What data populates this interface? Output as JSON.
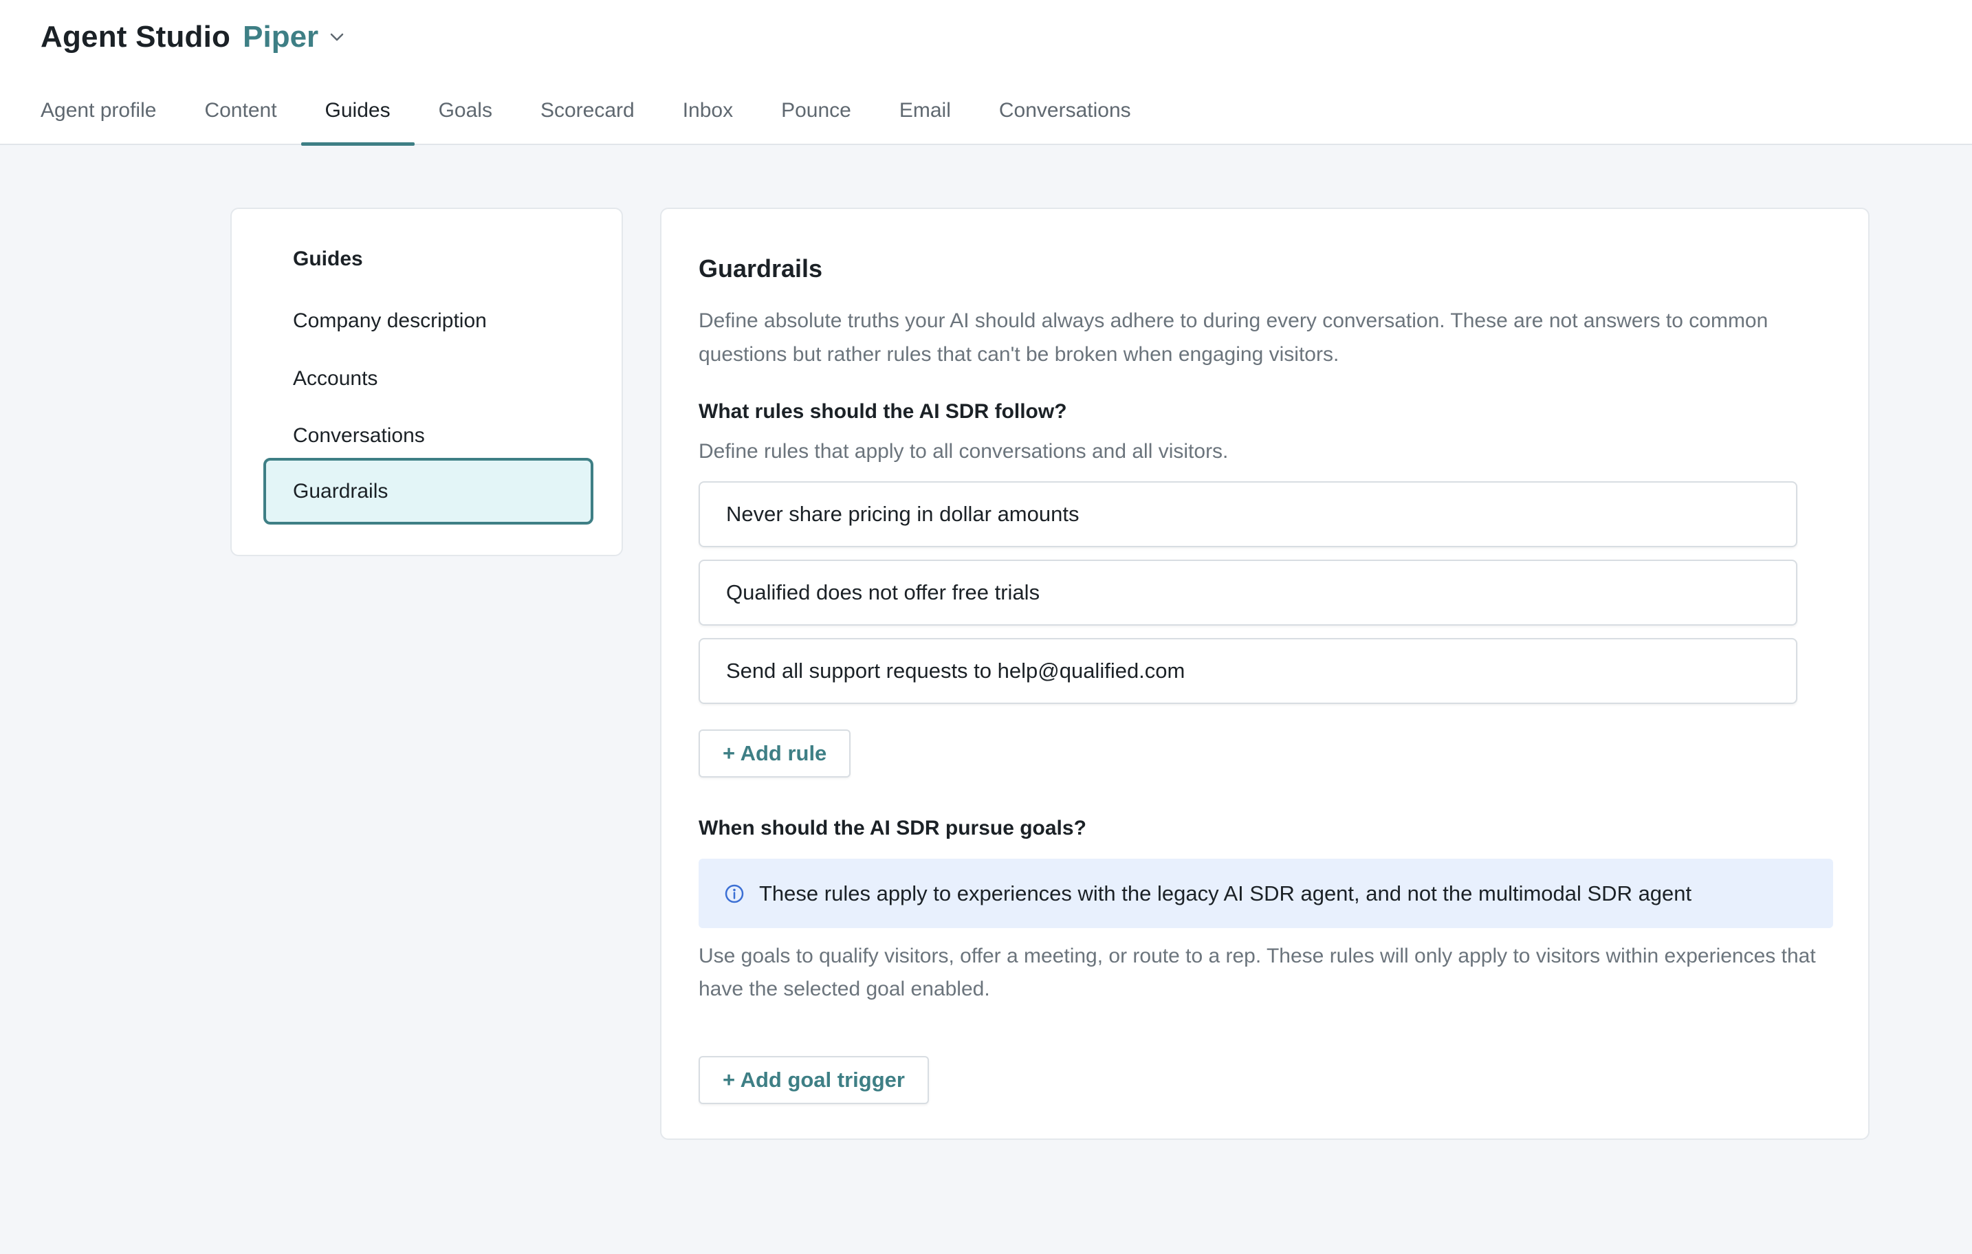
{
  "header": {
    "app_title": "Agent Studio",
    "agent_name": "Piper",
    "chevron_icon": "chevron-down-icon"
  },
  "tabs": [
    {
      "label": "Agent profile",
      "active": false
    },
    {
      "label": "Content",
      "active": false
    },
    {
      "label": "Guides",
      "active": true
    },
    {
      "label": "Goals",
      "active": false
    },
    {
      "label": "Scorecard",
      "active": false
    },
    {
      "label": "Inbox",
      "active": false
    },
    {
      "label": "Pounce",
      "active": false
    },
    {
      "label": "Email",
      "active": false
    },
    {
      "label": "Conversations",
      "active": false
    }
  ],
  "sidebar": {
    "heading": "Guides",
    "items": [
      {
        "label": "Company description",
        "active": false
      },
      {
        "label": "Accounts",
        "active": false
      },
      {
        "label": "Conversations",
        "active": false
      },
      {
        "label": "Guardrails",
        "active": true
      }
    ]
  },
  "main": {
    "title": "Guardrails",
    "description": "Define absolute truths your AI should always adhere to during every conversation. These are not answers to common questions but rather rules that can't be broken when engaging visitors.",
    "rules_section": {
      "heading": "What rules should the AI SDR follow?",
      "subtext": "Define rules that apply to all conversations and all visitors.",
      "rules": [
        "Never share pricing in dollar amounts",
        "Qualified does not offer free trials",
        "Send all support requests to help@qualified.com"
      ],
      "add_rule_label": "+ Add rule"
    },
    "goals_section": {
      "heading": "When should the AI SDR pursue goals?",
      "info_icon": "info-circle-icon",
      "info_text": "These rules apply to experiences with the legacy AI SDR agent, and not the multimodal SDR agent",
      "description": "Use goals to qualify visitors, offer a meeting, or route to a rep. These rules will only apply to visitors within experiences that have the selected goal enabled.",
      "add_goal_trigger_label": "+ Add goal trigger"
    }
  },
  "colors": {
    "accent": "#3e7f85",
    "active_bg": "#e3f5f7",
    "info_bg": "#e8f0fd",
    "info_icon": "#3b6fd4",
    "page_bg": "#f4f6f9"
  }
}
